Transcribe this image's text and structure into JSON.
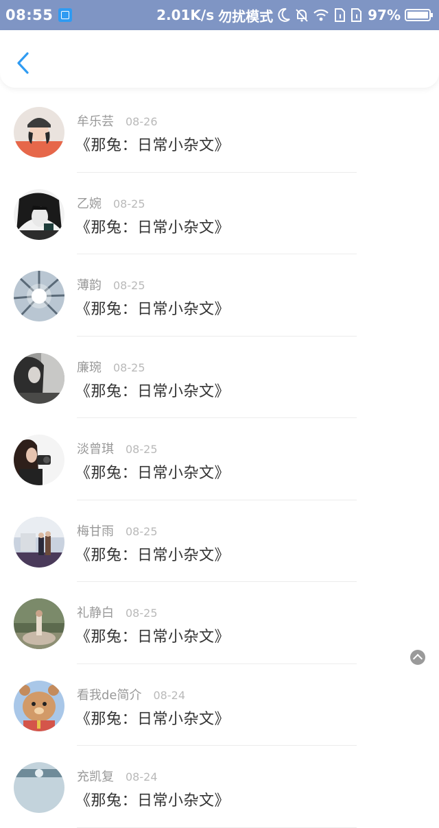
{
  "status_bar": {
    "time": "08:55",
    "network_speed": "2.01K/s",
    "mode": "勿扰模式",
    "battery": "97%",
    "icons": [
      "screenshot-icon",
      "moon-icon",
      "bell-off-icon",
      "wifi-icon",
      "sim1-icon",
      "sim2-icon",
      "battery-icon"
    ],
    "bg_color": "#7f95c4"
  },
  "header": {
    "back_icon": "chevron-left-icon",
    "accent": "#2f9bf2"
  },
  "feed": {
    "items": [
      {
        "name": "牟乐芸",
        "date": "08-26",
        "title": "《那兔：日常小杂文》"
      },
      {
        "name": "乙婉",
        "date": "08-25",
        "title": "《那兔：日常小杂文》"
      },
      {
        "name": "薄韵",
        "date": "08-25",
        "title": "《那兔：日常小杂文》"
      },
      {
        "name": "廉琬",
        "date": "08-25",
        "title": "《那兔：日常小杂文》"
      },
      {
        "name": "淡曾琪",
        "date": "08-25",
        "title": "《那兔：日常小杂文》"
      },
      {
        "name": "梅甘雨",
        "date": "08-25",
        "title": "《那兔：日常小杂文》"
      },
      {
        "name": "礼静白",
        "date": "08-25",
        "title": "《那兔：日常小杂文》"
      },
      {
        "name": "看我de简介",
        "date": "08-24",
        "title": "《那兔：日常小杂文》"
      },
      {
        "name": "充凯复",
        "date": "08-24",
        "title": "《那兔：日常小杂文》"
      }
    ]
  },
  "float_button": {
    "icon": "chevron-up-icon"
  }
}
